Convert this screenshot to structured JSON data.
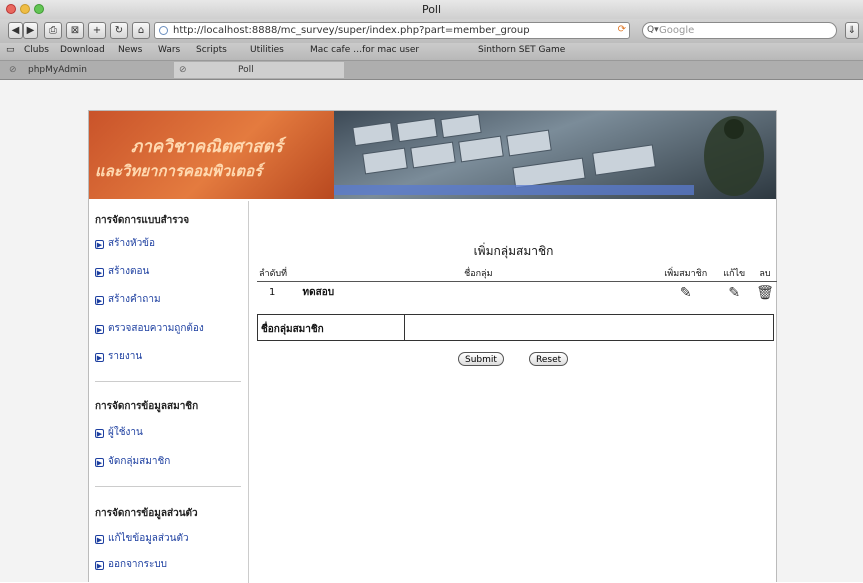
{
  "window": {
    "title": "Poll"
  },
  "toolbar": {
    "url": "http://localhost:8888/mc_survey/super/index.php?part=member_group",
    "search_placeholder": "Google"
  },
  "bookmarks": [
    "Clubs",
    "Download",
    "News",
    "Wars",
    "Scripts",
    "Utilities",
    "Mac cafe …for mac user",
    "Sinthorn SET Game"
  ],
  "tabs": [
    {
      "label": "phpMyAdmin",
      "active": false
    },
    {
      "label": "Poll",
      "active": true
    }
  ],
  "banner": {
    "line1": "ภาควิชาคณิตศาสตร์",
    "line2": "และวิทยาการคอมพิวเตอร์"
  },
  "sidebar": {
    "sections": [
      {
        "heading": "การจัดการแบบสำรวจ",
        "items": [
          "สร้างหัวข้อ",
          "สร้างตอน",
          "สร้างคำถาม",
          "ตรวจสอบความถูกต้อง",
          "รายงาน"
        ]
      },
      {
        "heading": "การจัดการข้อมูลสมาชิก",
        "items": [
          "ผู้ใช้งาน",
          "จัดกลุ่มสมาชิก"
        ]
      },
      {
        "heading": "การจัดการข้อมูลส่วนตัว",
        "items": [
          "แก้ไขข้อมูลส่วนตัว",
          "ออกจากระบบ"
        ]
      }
    ]
  },
  "content": {
    "title": "เพิ่มกลุ่มสมาชิก",
    "table": {
      "headers": [
        "ลำดับที่",
        "ชื่อกลุ่ม",
        "เพิ่มสมาชิก",
        "แก้ไข",
        "ลบ"
      ],
      "rows": [
        {
          "no": "1",
          "name": "ทดสอบ"
        }
      ]
    },
    "form": {
      "label": "ชื่อกลุ่มสมาชิก",
      "value": ""
    },
    "submit_label": "Submit",
    "reset_label": "Reset"
  }
}
